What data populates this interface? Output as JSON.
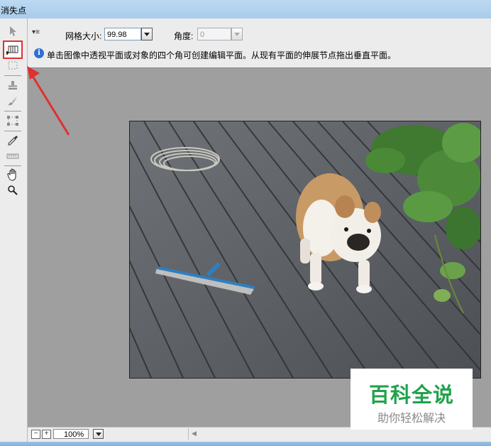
{
  "window": {
    "title": "消失点"
  },
  "toolbox": {
    "tools": [
      {
        "name": "edit-plane-tool",
        "icon": "pointer-icon",
        "selected": false
      },
      {
        "name": "create-plane-tool",
        "icon": "create-plane-icon",
        "selected": true
      },
      {
        "name": "marquee-tool",
        "icon": "marquee-icon",
        "selected": false
      },
      {
        "name": "stamp-tool",
        "icon": "stamp-icon",
        "selected": false
      },
      {
        "name": "brush-tool",
        "icon": "brush-icon",
        "selected": false
      },
      {
        "name": "transform-tool",
        "icon": "transform-icon",
        "selected": false
      },
      {
        "name": "eyedropper-tool",
        "icon": "eyedropper-icon",
        "selected": false
      },
      {
        "name": "measure-tool",
        "icon": "ruler-icon",
        "selected": false
      },
      {
        "name": "hand-tool",
        "icon": "hand-icon",
        "selected": false
      },
      {
        "name": "zoom-tool",
        "icon": "magnifier-icon",
        "selected": false
      }
    ]
  },
  "options": {
    "grid_size_label": "网格大小:",
    "grid_size_value": "99.98",
    "angle_label": "角度:",
    "angle_value": "0"
  },
  "info": {
    "icon": "info-icon",
    "text": "单击图像中透视平面或对象的四个角可创建编辑平面。从现有平面的伸展节点拖出垂直平面。"
  },
  "status": {
    "zoom_out": "−",
    "zoom_in": "+",
    "zoom_value": "100%"
  },
  "watermark": {
    "title": "百科全说",
    "subtitle": "助你轻松解决"
  },
  "colors": {
    "highlight": "#e03030",
    "watermark_green": "#1fa34b",
    "canvas_bg": "#9f9f9f"
  }
}
